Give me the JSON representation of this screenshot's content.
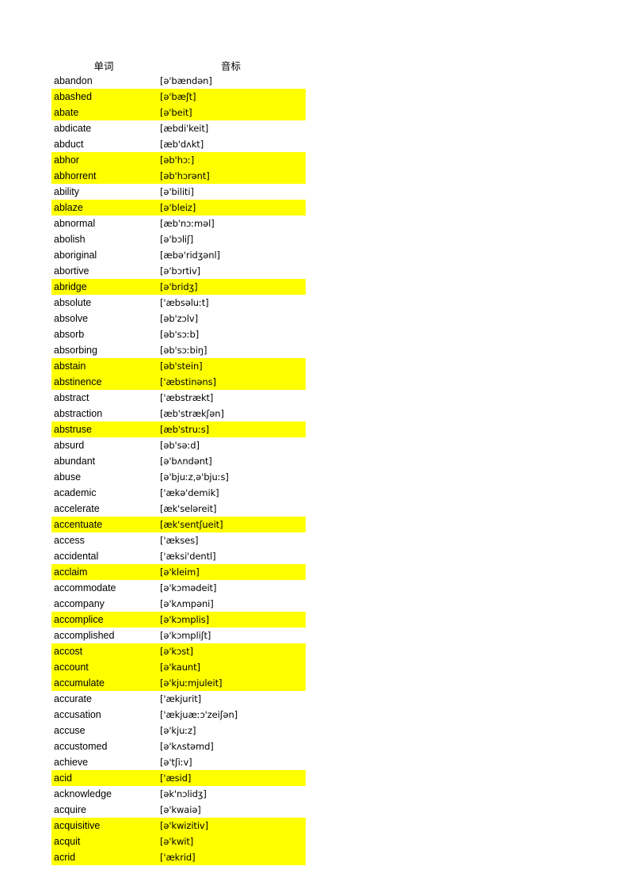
{
  "table": {
    "headers": {
      "word": "单词",
      "ipa": "音标"
    },
    "highlight_color": "#FFFF00",
    "background_color": "#FFFFFF",
    "rows": [
      {
        "word": "abandon",
        "ipa": "[ə'bændən]",
        "highlighted": false
      },
      {
        "word": "abashed",
        "ipa": "[ə'bæʃt]",
        "highlighted": true
      },
      {
        "word": "abate",
        "ipa": "[ə'beit]",
        "highlighted": true
      },
      {
        "word": "abdicate",
        "ipa": "[æbdi'keit]",
        "highlighted": false
      },
      {
        "word": "abduct",
        "ipa": "[æb'dʌkt]",
        "highlighted": false
      },
      {
        "word": "abhor",
        "ipa": "[əb'hɔː]",
        "highlighted": true
      },
      {
        "word": "abhorrent",
        "ipa": "[əb'hɔrənt]",
        "highlighted": true
      },
      {
        "word": "ability",
        "ipa": "[ə'biliti]",
        "highlighted": false
      },
      {
        "word": "ablaze",
        "ipa": "[ə'bleiz]",
        "highlighted": true
      },
      {
        "word": "abnormal",
        "ipa": "[æb'nɔːməl]",
        "highlighted": false
      },
      {
        "word": "abolish",
        "ipa": "[ə'bɔliʃ]",
        "highlighted": false
      },
      {
        "word": "aboriginal",
        "ipa": "[æbə'ridʒənl]",
        "highlighted": false
      },
      {
        "word": "abortive",
        "ipa": "[ə'bɔrtiv]",
        "highlighted": false
      },
      {
        "word": "abridge",
        "ipa": "[ə'bridʒ]",
        "highlighted": true
      },
      {
        "word": "absolute",
        "ipa": "['æbsəluːt]",
        "highlighted": false
      },
      {
        "word": "absolve",
        "ipa": "[əb'zɔlv]",
        "highlighted": false
      },
      {
        "word": "absorb",
        "ipa": "[əb'sɔːb]",
        "highlighted": false
      },
      {
        "word": "absorbing",
        "ipa": "[əb'sɔːbiŋ]",
        "highlighted": false
      },
      {
        "word": "abstain",
        "ipa": "[əb'stein]",
        "highlighted": true
      },
      {
        "word": "abstinence",
        "ipa": "['æbstinəns]",
        "highlighted": true
      },
      {
        "word": "abstract",
        "ipa": "['æbstrækt]",
        "highlighted": false
      },
      {
        "word": "abstraction",
        "ipa": "[æb'strækʃən]",
        "highlighted": false
      },
      {
        "word": "abstruse",
        "ipa": "[æb'struːs]",
        "highlighted": true
      },
      {
        "word": "absurd",
        "ipa": "[əb'səːd]",
        "highlighted": false
      },
      {
        "word": "abundant",
        "ipa": "[ə'bʌndənt]",
        "highlighted": false
      },
      {
        "word": "abuse",
        "ipa": "[ə'bjuːz,ə'bjuːs]",
        "highlighted": false
      },
      {
        "word": "academic",
        "ipa": "['ækə'demik]",
        "highlighted": false
      },
      {
        "word": "accelerate",
        "ipa": "[æk'seləreit]",
        "highlighted": false
      },
      {
        "word": "accentuate",
        "ipa": "[æk'sentʃueit]",
        "highlighted": true
      },
      {
        "word": "access",
        "ipa": "['ækses]",
        "highlighted": false
      },
      {
        "word": "accidental",
        "ipa": "['æksi'dentl]",
        "highlighted": false
      },
      {
        "word": "acclaim",
        "ipa": "[ə'kleim]",
        "highlighted": true
      },
      {
        "word": "accommodate",
        "ipa": "[ə'kɔmədeit]",
        "highlighted": false
      },
      {
        "word": "accompany",
        "ipa": "[ə'kʌmpəni]",
        "highlighted": false
      },
      {
        "word": "accomplice",
        "ipa": "[ə'kɔmplis]",
        "highlighted": true
      },
      {
        "word": "accomplished",
        "ipa": "[ə'kɔmpliʃt]",
        "highlighted": false
      },
      {
        "word": "accost",
        "ipa": "[ə'kɔst]",
        "highlighted": true
      },
      {
        "word": "account",
        "ipa": "[ə'kaunt]",
        "highlighted": true
      },
      {
        "word": "accumulate",
        "ipa": "[ə'kjuːmjuleit]",
        "highlighted": true
      },
      {
        "word": "accurate",
        "ipa": "['ækjurit]",
        "highlighted": false
      },
      {
        "word": "accusation",
        "ipa": "['ækjuæːɔ'zeiʃən]",
        "highlighted": false
      },
      {
        "word": "accuse",
        "ipa": "[ə'kjuːz]",
        "highlighted": false
      },
      {
        "word": "accustomed",
        "ipa": "[ə'kʌstəmd]",
        "highlighted": false
      },
      {
        "word": "achieve",
        "ipa": "[ə'tʃiːv]",
        "highlighted": false
      },
      {
        "word": "acid",
        "ipa": "['æsid]",
        "highlighted": true
      },
      {
        "word": "acknowledge",
        "ipa": "[ək'nɔlidʒ]",
        "highlighted": false
      },
      {
        "word": "acquire",
        "ipa": "[ə'kwaiə]",
        "highlighted": false
      },
      {
        "word": "acquisitive",
        "ipa": "[ə'kwizitiv]",
        "highlighted": true
      },
      {
        "word": "acquit",
        "ipa": "[ə'kwit]",
        "highlighted": true
      },
      {
        "word": "acrid",
        "ipa": "['ækrid]",
        "highlighted": true
      }
    ]
  }
}
